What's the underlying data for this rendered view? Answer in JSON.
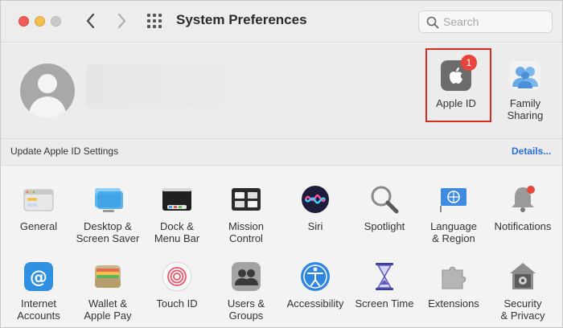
{
  "window": {
    "title": "System Preferences",
    "search_placeholder": "Search",
    "controls": [
      "close",
      "minimize",
      "zoom"
    ]
  },
  "colors": {
    "highlight_border": "#d82a1f",
    "badge": "#e8453c",
    "link": "#2a6ed8"
  },
  "account": {
    "apple_id_label": "Apple ID",
    "apple_id_badge": "1",
    "family_label_1": "Family",
    "family_label_2": "Sharing",
    "update_text": "Update Apple ID Settings",
    "details_link": "Details..."
  },
  "prefs": [
    {
      "icon": "general-icon",
      "line1": "General",
      "line2": ""
    },
    {
      "icon": "desktop-screen-saver-icon",
      "line1": "Desktop &",
      "line2": "Screen Saver"
    },
    {
      "icon": "dock-menu-bar-icon",
      "line1": "Dock &",
      "line2": "Menu Bar"
    },
    {
      "icon": "mission-control-icon",
      "line1": "Mission",
      "line2": "Control"
    },
    {
      "icon": "siri-icon",
      "line1": "Siri",
      "line2": ""
    },
    {
      "icon": "spotlight-icon",
      "line1": "Spotlight",
      "line2": ""
    },
    {
      "icon": "language-region-icon",
      "line1": "Language",
      "line2": "& Region"
    },
    {
      "icon": "notifications-icon",
      "line1": "Notifications",
      "line2": ""
    },
    {
      "icon": "internet-accounts-icon",
      "line1": "Internet",
      "line2": "Accounts"
    },
    {
      "icon": "wallet-apple-pay-icon",
      "line1": "Wallet &",
      "line2": "Apple Pay"
    },
    {
      "icon": "touch-id-icon",
      "line1": "Touch ID",
      "line2": ""
    },
    {
      "icon": "users-groups-icon",
      "line1": "Users &",
      "line2": "Groups"
    },
    {
      "icon": "accessibility-icon",
      "line1": "Accessibility",
      "line2": ""
    },
    {
      "icon": "screen-time-icon",
      "line1": "Screen Time",
      "line2": ""
    },
    {
      "icon": "extensions-icon",
      "line1": "Extensions",
      "line2": ""
    },
    {
      "icon": "security-privacy-icon",
      "line1": "Security",
      "line2": "& Privacy"
    }
  ]
}
